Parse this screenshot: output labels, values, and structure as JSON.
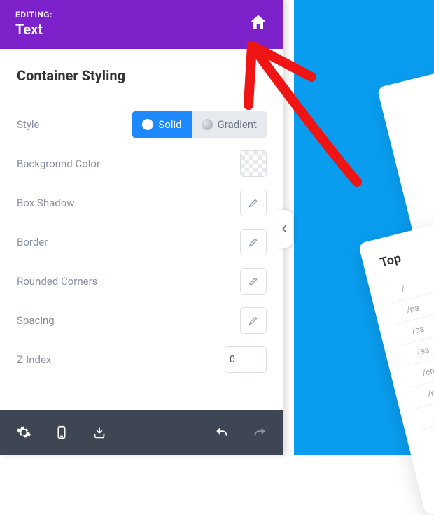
{
  "header": {
    "editing_label": "EDITING:",
    "editing_value": "Text"
  },
  "section": {
    "title": "Container Styling"
  },
  "style_row": {
    "label": "Style",
    "solid": "Solid",
    "gradient": "Gradient"
  },
  "rows": {
    "background_color": "Background Color",
    "box_shadow": "Box Shadow",
    "border": "Border",
    "rounded_corners": "Rounded Corners",
    "spacing": "Spacing",
    "z_index": "Z-Index"
  },
  "z_index_value": "0",
  "preview": {
    "card2_title": "Top",
    "rows": [
      "/",
      "/pa",
      "/ca",
      "/sa",
      "/ch",
      "/m",
      "/m"
    ]
  }
}
